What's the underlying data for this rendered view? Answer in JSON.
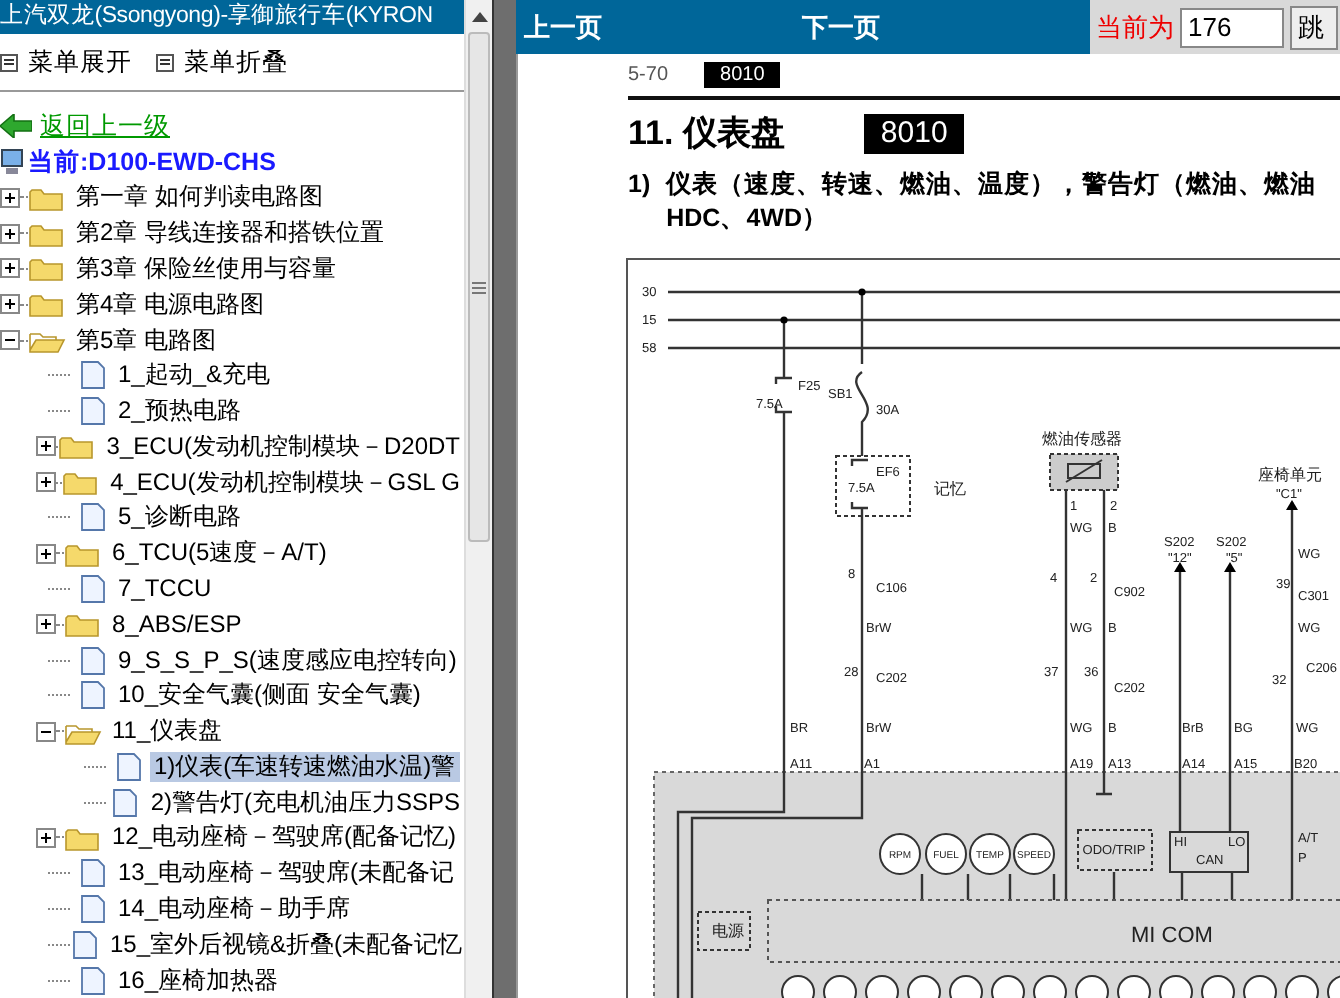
{
  "left_panel": {
    "title": "上汽双龙(Ssongyong)-享御旅行车(KYRON",
    "menu": [
      {
        "label": "菜单展开"
      },
      {
        "label": "菜单折叠"
      }
    ],
    "back_link": "返回上一级",
    "current": "当前:D100-EWD-CHS",
    "tree": [
      {
        "label": "第一章 如何判读电路图",
        "kind": "folder",
        "expanded": false,
        "selected": false
      },
      {
        "label": "第2章 导线连接器和搭铁位置",
        "kind": "folder",
        "expanded": false,
        "selected": false
      },
      {
        "label": "第3章 保险丝使用与容量",
        "kind": "folder",
        "expanded": false,
        "selected": false
      },
      {
        "label": "第4章 电源电路图",
        "kind": "folder",
        "expanded": false,
        "selected": false
      },
      {
        "label": "第5章 电路图",
        "kind": "folder",
        "expanded": true,
        "selected": false,
        "children": [
          {
            "label": "1_起动_&充电",
            "kind": "document",
            "selected": false
          },
          {
            "label": "2_预热电路",
            "kind": "document",
            "selected": false
          },
          {
            "label": "3_ECU(发动机控制模块－D20DT",
            "kind": "folder",
            "expanded": false,
            "selected": false
          },
          {
            "label": "4_ECU(发动机控制模块－GSL G",
            "kind": "folder",
            "expanded": false,
            "selected": false
          },
          {
            "label": "5_诊断电路",
            "kind": "document",
            "selected": false
          },
          {
            "label": "6_TCU(5速度－A/T)",
            "kind": "folder",
            "expanded": false,
            "selected": false
          },
          {
            "label": "7_TCCU",
            "kind": "document",
            "selected": false
          },
          {
            "label": "8_ABS/ESP",
            "kind": "folder",
            "expanded": false,
            "selected": false
          },
          {
            "label": "9_S_S_P_S(速度感应电控转向)",
            "kind": "document",
            "selected": false
          },
          {
            "label": "10_安全气囊(侧面 安全气囊)",
            "kind": "document",
            "selected": false
          },
          {
            "label": "11_仪表盘",
            "kind": "folder",
            "expanded": true,
            "selected": false,
            "children": [
              {
                "label": "1)仪表(车速转速燃油水温)警",
                "kind": "document",
                "selected": true
              },
              {
                "label": "2)警告灯(充电机油压力SSPS",
                "kind": "document",
                "selected": false
              }
            ]
          },
          {
            "label": "12_电动座椅－驾驶席(配备记忆)",
            "kind": "folder",
            "expanded": false,
            "selected": false
          },
          {
            "label": "13_电动座椅－驾驶席(未配备记",
            "kind": "document",
            "selected": false
          },
          {
            "label": "14_电动座椅－助手席",
            "kind": "document",
            "selected": false
          },
          {
            "label": "15_室外后视镜&折叠(未配备记忆",
            "kind": "document",
            "selected": false
          },
          {
            "label": "16_座椅加热器",
            "kind": "document",
            "selected": false
          }
        ]
      }
    ]
  },
  "viewer": {
    "toolbar": {
      "prev": "上一页",
      "next": "下一页",
      "page_label": "当前为",
      "page_value": "176",
      "go_button": "跳"
    },
    "document": {
      "page_number": "5-70",
      "page_code": "8010",
      "heading": "11. 仪表盘",
      "heading_code": "8010",
      "caption": {
        "number": "1)",
        "lines": [
          "仪表（速度、转速、燃油、温度），警告灯（燃油、燃油",
          "HDC、4WD）"
        ]
      },
      "diagram": {
        "bus_labels": [
          "30",
          "15",
          "58"
        ],
        "labels": [
          "F25",
          "7.5A",
          "SB1",
          "30A",
          "EF6",
          "7.5A",
          "记忆",
          "燃油传感器",
          "1",
          "2",
          "WG",
          "B",
          "S202",
          "\"12\"",
          "S202",
          "\"5\"",
          "座椅单元",
          "\"C1\"",
          "WG",
          "8",
          "C106",
          "4",
          "2",
          "C902",
          "39",
          "C301",
          "BrW",
          "WG",
          "B",
          "WG",
          "28",
          "C202",
          "37",
          "36",
          "C202",
          "32",
          "C206",
          "BR",
          "BrW",
          "WG",
          "B",
          "BrB",
          "BG",
          "WG",
          "A11",
          "A1",
          "A19",
          "A13",
          "A14",
          "A15",
          "B20",
          "A/T",
          "P"
        ],
        "gauges": [
          "RPM",
          "FUEL",
          "TEMP",
          "SPEED"
        ],
        "odo": "ODO/TRIP",
        "can": {
          "high": "HI",
          "low": "LO",
          "name": "CAN"
        },
        "module": "MI COM",
        "power": "电源"
      }
    }
  }
}
